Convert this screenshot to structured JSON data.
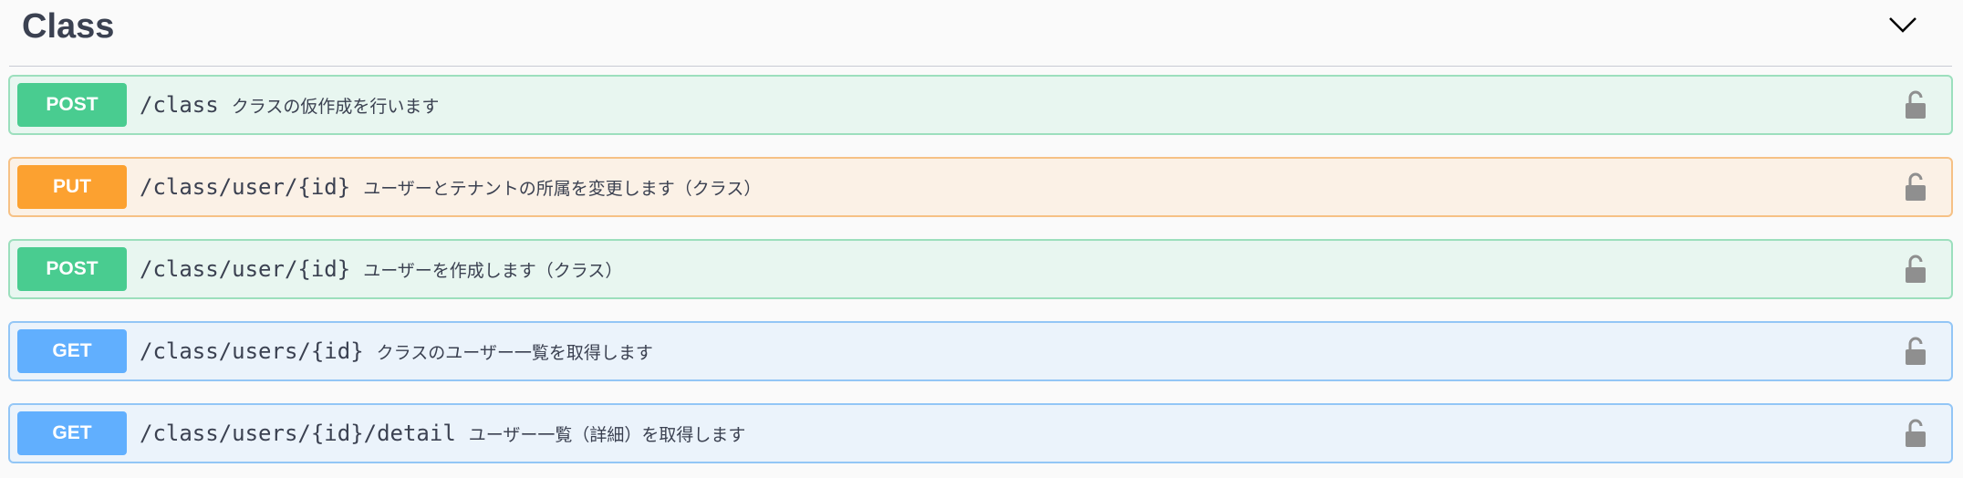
{
  "section": {
    "title": "Class",
    "expanded": true
  },
  "operations": [
    {
      "method": "POST",
      "path": "/class",
      "summary": "クラスの仮作成を行います",
      "color": "#49cc90"
    },
    {
      "method": "PUT",
      "path": "/class/user/{id}",
      "summary": "ユーザーとテナントの所属を変更します（クラス）",
      "color": "#fca130"
    },
    {
      "method": "POST",
      "path": "/class/user/{id}",
      "summary": "ユーザーを作成します（クラス）",
      "color": "#49cc90"
    },
    {
      "method": "GET",
      "path": "/class/users/{id}",
      "summary": "クラスのユーザー一覧を取得します",
      "color": "#61affe"
    },
    {
      "method": "GET",
      "path": "/class/users/{id}/detail",
      "summary": "ユーザー一覧（詳細）を取得します",
      "color": "#61affe"
    }
  ],
  "icons": {
    "collapse": "chevron-down-icon",
    "auth": "unlocked-padlock-icon"
  }
}
